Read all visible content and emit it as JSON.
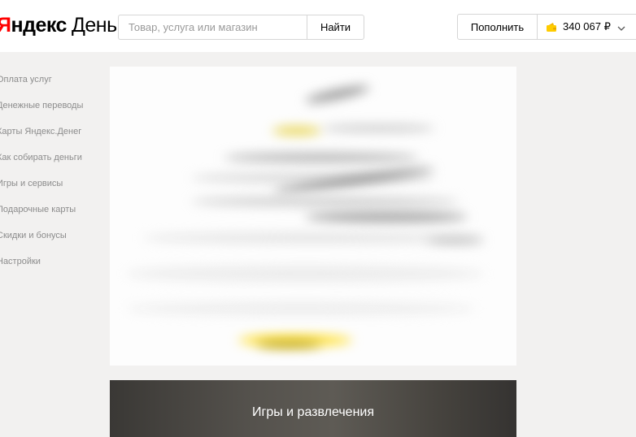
{
  "header": {
    "logo": {
      "part1": "Я",
      "part2": "ндекс",
      "part3": "Деньги"
    },
    "search": {
      "placeholder": "Товар, услуга или магазин",
      "button_label": "Найти"
    },
    "topup_label": "Пополнить",
    "balance": {
      "amount": "340 067 ₽",
      "icon": "wallet-icon"
    }
  },
  "sidebar": {
    "items": [
      {
        "label": "Оплата услуг"
      },
      {
        "label": "Денежные переводы"
      },
      {
        "label": "Карты Яндекс.Денег"
      },
      {
        "label": "Как собирать деньги"
      },
      {
        "label": "Игры и сервисы"
      },
      {
        "label": "Подарочные карты"
      },
      {
        "label": "Скидки и бонусы"
      },
      {
        "label": "Настройки"
      }
    ]
  },
  "main": {
    "category_card": {
      "title": "Игры и развлечения"
    }
  },
  "colors": {
    "brand_red": "#ff0000",
    "accent_yellow": "#ffdb4d",
    "background": "#f2f1f0"
  }
}
